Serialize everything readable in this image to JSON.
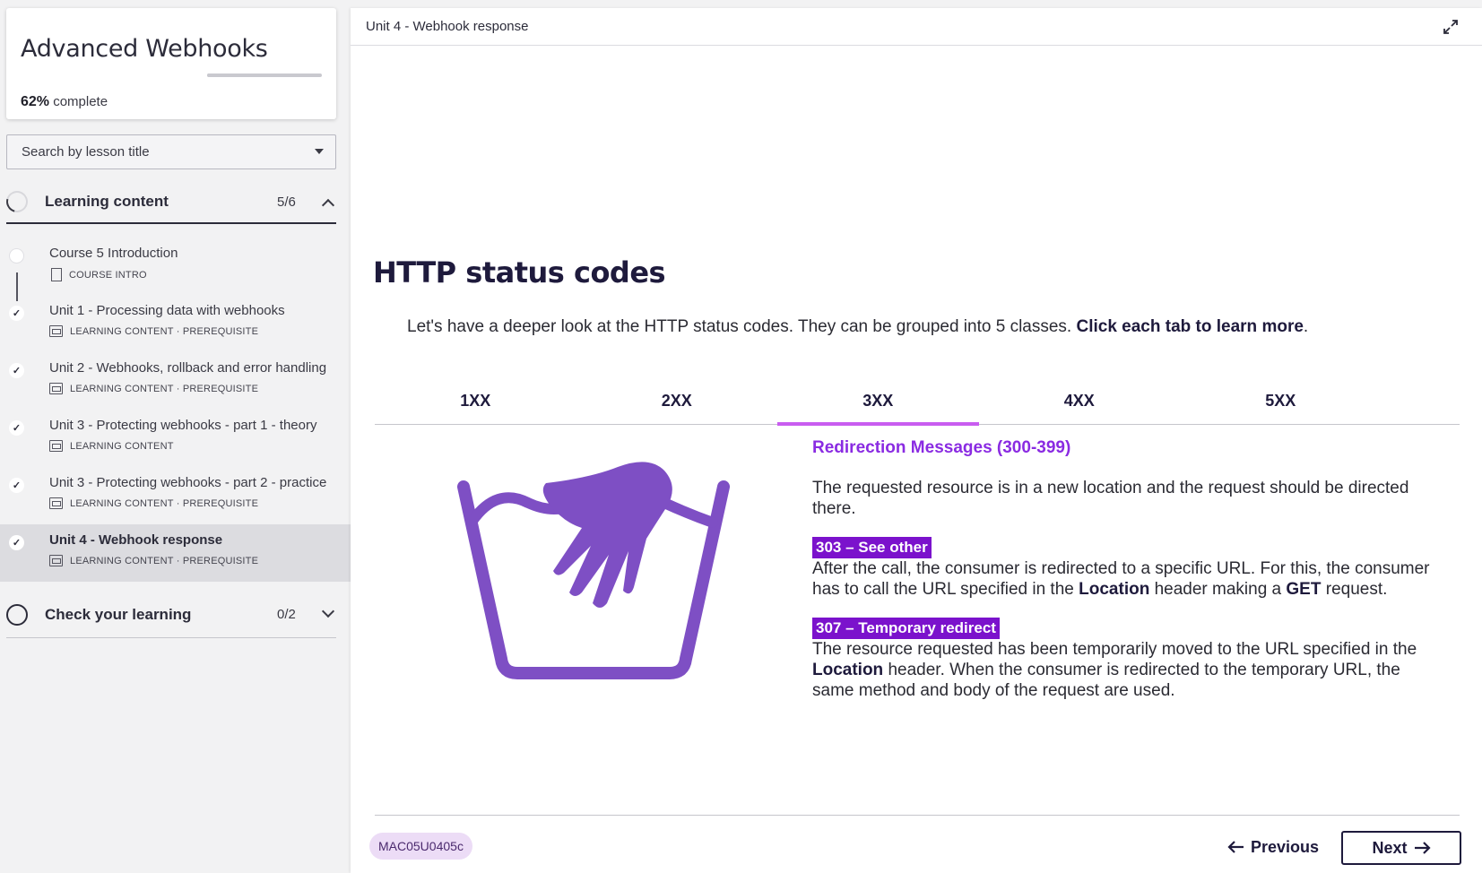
{
  "sidebar": {
    "course_title": "Advanced Webhooks",
    "progress_percent": "62%",
    "progress_suffix": "complete",
    "progress_fraction": 0.62,
    "search_placeholder": "Search by lesson title",
    "sections": [
      {
        "label": "Learning content",
        "count": "5/6",
        "expanded": true
      },
      {
        "label": "Check your learning",
        "count": "0/2",
        "expanded": false
      }
    ],
    "lessons": [
      {
        "title": "Course 5 Introduction",
        "meta": "COURSE INTRO",
        "completed": false
      },
      {
        "title": "Unit 1 - Processing data with webhooks",
        "meta": "LEARNING CONTENT · PREREQUISITE",
        "completed": true
      },
      {
        "title": "Unit 2 - Webhooks, rollback and error handling",
        "meta": "LEARNING CONTENT · PREREQUISITE",
        "completed": true
      },
      {
        "title": "Unit 3 - Protecting webhooks - part 1 - theory",
        "meta": "LEARNING CONTENT",
        "completed": true
      },
      {
        "title": "Unit 3 - Protecting webhooks - part 2 - practice",
        "meta": "LEARNING CONTENT · PREREQUISITE",
        "completed": true
      },
      {
        "title": "Unit 4 - Webhook response",
        "meta": "LEARNING CONTENT · PREREQUISITE",
        "completed": true,
        "active": true
      }
    ]
  },
  "main": {
    "topbar_title": "Unit 4 - Webhook response",
    "heading": "HTTP status codes",
    "intro_text": "Let's have a deeper look at the HTTP status codes. They can be grouped into 5 classes. ",
    "intro_bold": "Click each tab to learn more",
    "intro_end": ".",
    "tabs": [
      "1XX",
      "2XX",
      "3XX",
      "4XX",
      "5XX"
    ],
    "active_tab": "3XX",
    "content": {
      "heading": "Redirection Messages (300-399)",
      "para1": "The requested resource is in a new location and the request should be directed there.",
      "badge1": "303 – See other",
      "para2_a": "After the call, the consumer is redirected to a specific URL. For this, the consumer has to call the URL specified in the ",
      "para2_b1": "Location",
      "para2_c": " header making a ",
      "para2_b2": "GET",
      "para2_d": " request.",
      "badge2": "307 – Temporary redirect",
      "para3_a": "The resource requested has been temporarily moved to the URL specified in the ",
      "para3_b": "Location",
      "para3_c": " header.  When the consumer is redirected to the temporary URL, the same method and body of the request are used."
    },
    "lesson_code": "MAC05U0405c",
    "prev_label": "Previous",
    "next_label": "Next"
  },
  "colors": {
    "accent_purple": "#8a2be2",
    "badge_purple": "#7b12cc",
    "tab_underline": "#c95df0",
    "illustration": "#7e4fc4",
    "dark_text": "#1e1a3c"
  },
  "icons": [
    "expand-icon",
    "chevron-up-icon",
    "chevron-down-icon",
    "checkmark-icon",
    "document-icon",
    "arrow-left-icon",
    "arrow-right-icon",
    "hand-wash-icon"
  ]
}
